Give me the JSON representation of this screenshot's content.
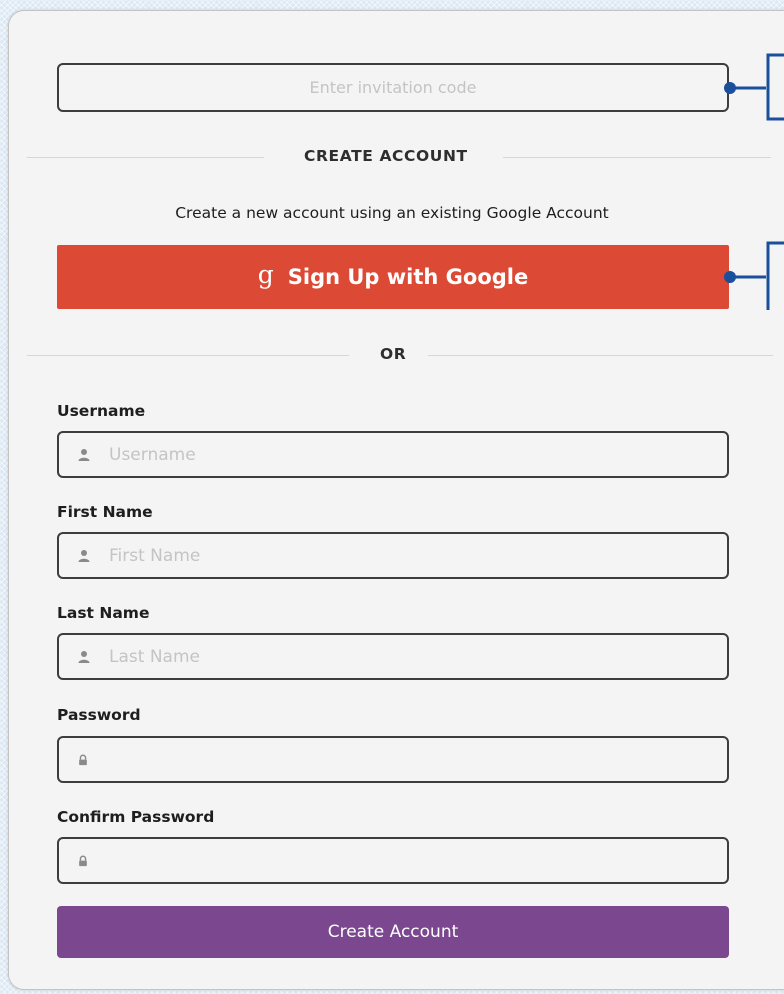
{
  "invite": {
    "placeholder": "Enter invitation code"
  },
  "create_section": {
    "heading": "CREATE ACCOUNT",
    "description": "Create a new account using an existing Google Account",
    "google_button_label": "Sign Up with Google",
    "google_glyph": "g",
    "or_label": "OR"
  },
  "form": {
    "username": {
      "label": "Username",
      "placeholder": "Username",
      "icon": "user-icon"
    },
    "first_name": {
      "label": "First Name",
      "placeholder": "First Name",
      "icon": "user-icon"
    },
    "last_name": {
      "label": "Last Name",
      "placeholder": "Last Name",
      "icon": "user-icon"
    },
    "password": {
      "label": "Password",
      "placeholder": "",
      "icon": "lock-icon"
    },
    "confirm_password": {
      "label": "Confirm Password",
      "placeholder": "",
      "icon": "lock-icon"
    },
    "submit_label": "Create Account"
  },
  "colors": {
    "google_red": "#dc4a35",
    "submit_purple": "#7b4890",
    "callout_blue": "#1a4f9c",
    "panel_bg": "#f4f4f4"
  }
}
